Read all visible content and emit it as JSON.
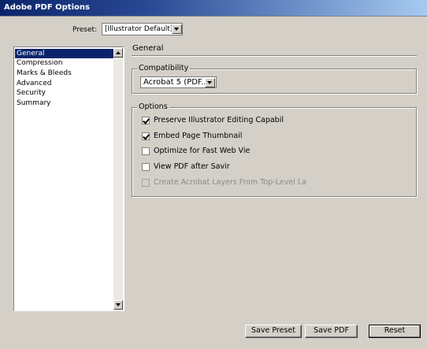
{
  "window": {
    "title": "Adobe PDF Options"
  },
  "preset": {
    "label": "Preset:",
    "value": "[Illustrator Default]"
  },
  "sidebar": {
    "items": [
      {
        "label": "General",
        "selected": true
      },
      {
        "label": "Compression",
        "selected": false
      },
      {
        "label": "Marks & Bleeds",
        "selected": false
      },
      {
        "label": "Advanced",
        "selected": false
      },
      {
        "label": "Security",
        "selected": false
      },
      {
        "label": "Summary",
        "selected": false
      }
    ]
  },
  "main": {
    "section_title": "General",
    "compatibility": {
      "legend": "Compatibility",
      "value": "Acrobat 5 (PDF..."
    },
    "options": {
      "legend": "Options",
      "items": [
        {
          "label": "Preserve Illustrator Editing Capabil",
          "checked": true,
          "enabled": true
        },
        {
          "label": "Embed Page Thumbnail",
          "checked": true,
          "enabled": true
        },
        {
          "label": "Optimize for Fast Web Vie",
          "checked": false,
          "enabled": true
        },
        {
          "label": "View PDF after Savir",
          "checked": false,
          "enabled": true
        },
        {
          "label": "Create Acrobat Layers From Top-Level La",
          "checked": false,
          "enabled": false
        }
      ]
    }
  },
  "buttons": {
    "save_preset": "Save Preset",
    "save_pdf": "Save PDF",
    "reset": "Reset"
  },
  "colors": {
    "titlebar": "#0a246a",
    "face": "#d4d0c8",
    "selection": "#0a246a"
  }
}
